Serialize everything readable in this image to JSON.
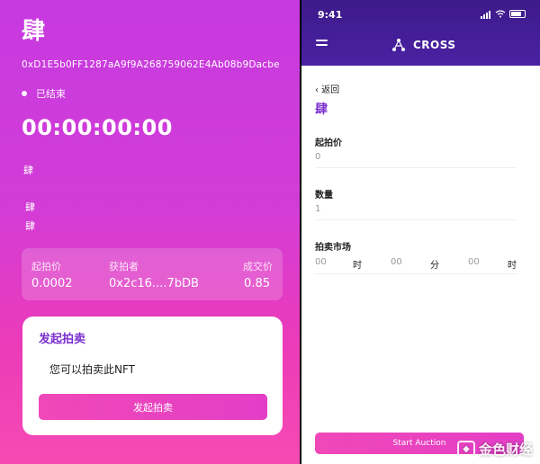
{
  "left": {
    "title": "肆",
    "address": "0xD1E5b0FF1287aA9f9A268759062E4Ab08b9Dacbe",
    "status": "已结束",
    "timer": "00:00:00:00",
    "line1": "肆",
    "line2": "肆",
    "line3": "肆",
    "stats": {
      "start_price_label": "起拍价",
      "winner_label": "获拍者",
      "deal_price_label": "成交价",
      "start_price": "0.0002",
      "winner": "0x2c16....7bDB",
      "deal_price": "0.85"
    },
    "card": {
      "title": "发起拍卖",
      "text": "您可以拍卖此NFT",
      "button": "发起拍卖"
    }
  },
  "right": {
    "time": "9:41",
    "brand": "CROSS",
    "back": "‹ 返回",
    "name": "肆",
    "start_price_label": "起拍价",
    "start_price_value": "0",
    "quantity_label": "数量",
    "quantity_value": "1",
    "market_label": "拍卖市场",
    "hours_value": "00",
    "hours_unit": "时",
    "minutes_value": "00",
    "minutes_unit": "分",
    "seconds_value": "00",
    "seconds_unit": "时",
    "button": "Start Auction"
  },
  "watermark": "金色财经",
  "icons": {
    "menu": "hamburger-menu-icon",
    "brand": "cross-logo-icon",
    "wifi": "wifi-icon",
    "signal": "signal-icon",
    "battery": "battery-icon"
  },
  "colors": {
    "accent_purple": "#7b2fcf",
    "pink": "#f048b8",
    "header": "#3d1a8a"
  }
}
